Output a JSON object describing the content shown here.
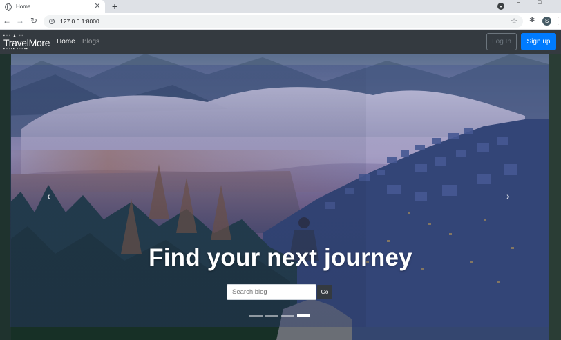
{
  "browser": {
    "tab_title": "Home",
    "tab_close": "✕",
    "new_tab": "+",
    "url": "127.0.0.1:8000",
    "profile_initial": "S",
    "minimize": "–",
    "maximize": "□"
  },
  "navbar": {
    "brand_name": "TravelMore",
    "brand_deco_top": "▪▪▪▪ ▲ ▪▪▪",
    "brand_deco_bottom": "▪▪▪▪▪▪ ▪▪▪▪▪▪",
    "links": [
      {
        "label": "Home",
        "active": true
      },
      {
        "label": "Blogs",
        "active": false
      }
    ],
    "login_label": "Log In",
    "signup_label": "Sign up"
  },
  "hero": {
    "headline": "Find your next journey",
    "search_placeholder": "Search blog",
    "go_label": "Go",
    "prev_arrow": "‹",
    "next_arrow": "›",
    "slide_count": 4,
    "active_slide": 4
  },
  "colors": {
    "navbar_bg": "#343a40",
    "primary": "#007bff",
    "outline_secondary": "#6c757d"
  },
  "icons": {
    "tab_favicon": "globe-icon",
    "back": "arrow-left-icon",
    "forward": "arrow-right-icon",
    "reload": "reload-icon",
    "site_info": "info-icon",
    "bookmark": "star-icon",
    "extensions": "puzzle-icon",
    "menu": "kebab-menu-icon",
    "carousel_prev": "chevron-left-icon",
    "carousel_next": "chevron-right-icon"
  }
}
